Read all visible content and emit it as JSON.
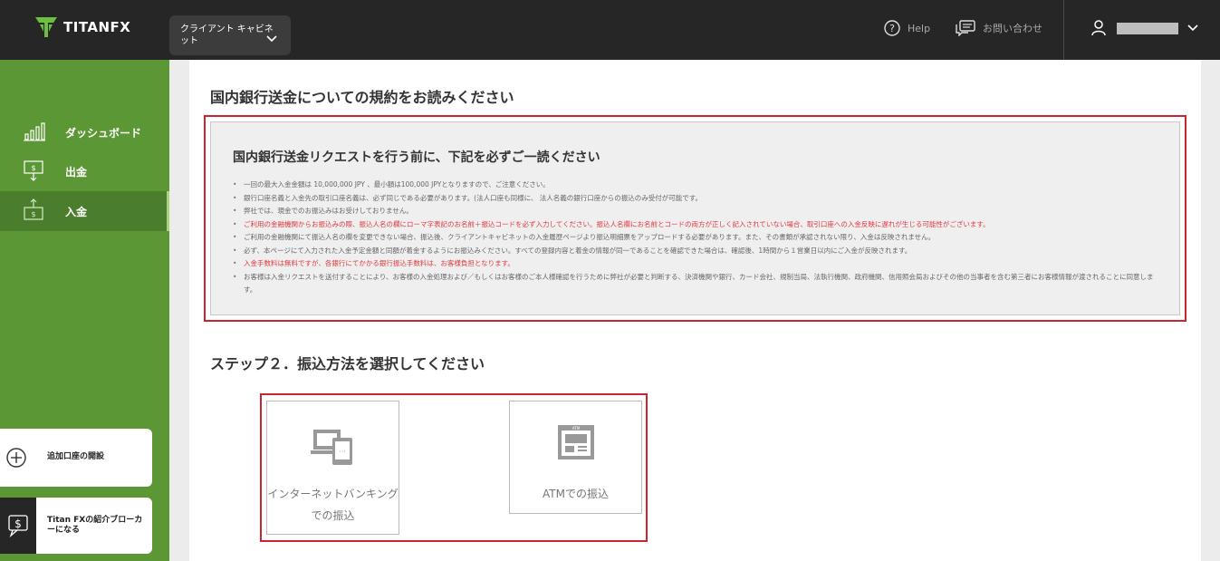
{
  "header": {
    "logo_text": "TITANFX",
    "cabinet_label": "クライアント キャビネット",
    "help_label": "Help",
    "contact_label": "お問い合わせ"
  },
  "sidebar": {
    "items": [
      {
        "label": "ダッシュボード",
        "icon": "bar-chart-icon"
      },
      {
        "label": "出金",
        "icon": "withdraw-icon"
      },
      {
        "label": "入金",
        "icon": "deposit-icon",
        "active": true
      }
    ],
    "cards": [
      {
        "label": "追加口座の開設",
        "icon": "plus-circle-icon"
      },
      {
        "label": "Titan FXの紹介ブローカーになる",
        "icon": "dollar-chat-icon"
      }
    ]
  },
  "main": {
    "terms_title": "国内銀行送金についての規約をお読みください",
    "terms_heading": "国内銀行送金リクエストを行う前に、下記を必ずご一読ください",
    "terms": [
      {
        "text": "一回の最大入金金額は 10,000,000 JPY 、最小額は100,000 JPYとなりますので、ご注意ください。",
        "red": false
      },
      {
        "text": "銀行口座名義と入金先の取引口座名義は、必ず同じである必要があります。(法人口座も同様に、 法人名義の銀行口座からの振込のみ受付が可能です。",
        "red": false
      },
      {
        "text": "弊社では、現金でのお振込みはお受けしておりません。",
        "red": false
      },
      {
        "text": "ご利用の金融機関からお振込みの際、振込人名の欄にローマ字表記のお名前＋振込コードを必ず入力してください。振込人名欄にお名前とコードの両方が正しく記入されていない場合、取引口座への入金反映に遅れが生じる可能性がございます。",
        "red": true
      },
      {
        "text": "ご利用の金融機関にて振込人名の欄を変更できない場合、振込後、クライアントキャビネットの入金履歴ページより振込明細票をアップロードする必要があります。また、その書類が承認されない限り、入金は反映されません。",
        "red": false
      },
      {
        "text": "必ず、本ページにて入力された入金予定金額と同額が着金するようにお振込みください。すべての登録内容と着金の情報が同一であることを確認できた場合は、確認後、1時間から１営業日以内にご入金が反映されます。",
        "red": false
      },
      {
        "text": "入金手数料は無料ですが、各銀行にてかかる銀行振込手数料は、お客様負担となります。",
        "red": true
      },
      {
        "text": "お客様は入金リクエストを送付することにより、お客様の入金処理および／もしくはお客様のご本人様確認を行うために弊社が必要と判断する、決済機関や銀行、カード会社、規制当局、法執行機関、政府機関、信用照会局およびその他の当事者を含む第三者にお客様情報が渡されることに同意します。",
        "red": false,
        "wrap": true
      }
    ],
    "step_title": "ステップ２．振込方法を選択してください",
    "methods": [
      {
        "label_line1": "インターネットバンキング",
        "label_line2": "での振込",
        "icon": "devices-icon"
      },
      {
        "label_line1": "ATMでの振込",
        "icon": "atm-icon"
      }
    ]
  },
  "colors": {
    "topbar": "#262626",
    "sidebar_green": "#5c9735",
    "highlight_red": "#c9252f",
    "warning_red": "#e0393e"
  }
}
